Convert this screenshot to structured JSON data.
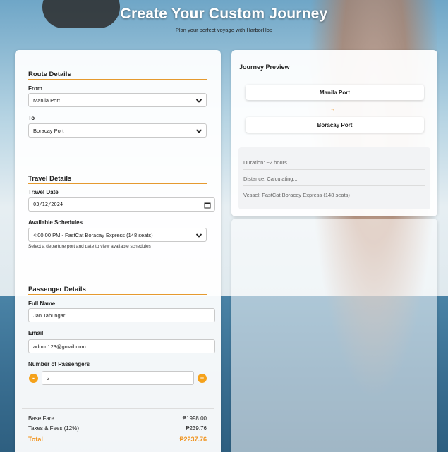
{
  "header": {
    "title": "Create Your Custom Journey",
    "subtitle": "Plan your perfect voyage with HarborHop"
  },
  "route": {
    "section_title": "Route Details",
    "from_label": "From",
    "from_value": "Manila Port",
    "to_label": "To",
    "to_value": "Boracay Port"
  },
  "travel": {
    "section_title": "Travel Details",
    "date_label": "Travel Date",
    "date_value": "03/12/2024",
    "schedules_label": "Available Schedules",
    "schedule_value": "4:00:00 PM - FastCat Boracay Express (148 seats)",
    "hint": "Select a departure port and date to view available schedules"
  },
  "passenger": {
    "section_title": "Passenger Details",
    "name_label": "Full Name",
    "name_value": "Jan Tabungar",
    "email_label": "Email",
    "email_value": "admin123@gmail.com",
    "count_label": "Number of Passengers",
    "count_value": "2",
    "minus": "-",
    "plus": "+"
  },
  "pricing": {
    "base_label": "Base Fare",
    "base_value": "₱1998.00",
    "tax_label": "Taxes & Fees (12%)",
    "tax_value": "₱239.76",
    "total_label": "Total",
    "total_value": "₱2237.76"
  },
  "preview": {
    "title": "Journey Preview",
    "origin": "Manila Port",
    "arrow": "→",
    "destination": "Boracay Port",
    "duration": "Duration: ~2 hours",
    "distance": "Distance: Calculating...",
    "vessel": "Vessel: FastCat Boracay Express (148 seats)"
  },
  "colors": {
    "accent": "#f5a21b",
    "total": "#f0931c"
  },
  "icons": {
    "select": "chevron-down-icon",
    "date": "calendar-icon"
  }
}
